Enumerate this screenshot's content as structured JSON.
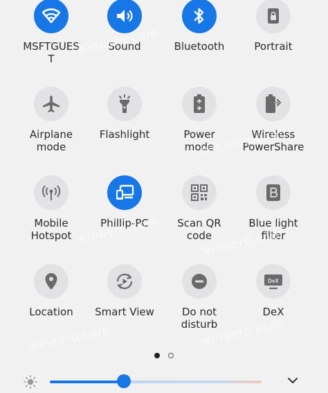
{
  "tiles": [
    {
      "label": "MSFTGUES\nT",
      "icon": "wifi-icon",
      "on": true
    },
    {
      "label": "Sound",
      "icon": "sound-icon",
      "on": true
    },
    {
      "label": "Bluetooth",
      "icon": "bluetooth-icon",
      "on": true
    },
    {
      "label": "Portrait",
      "icon": "portrait-lock-icon",
      "on": false
    },
    {
      "label": "Airplane\nmode",
      "icon": "airplane-icon",
      "on": false
    },
    {
      "label": "Flashlight",
      "icon": "flashlight-icon",
      "on": false
    },
    {
      "label": "Power\nmode",
      "icon": "power-mode-icon",
      "on": false
    },
    {
      "label": "Wireless\nPowerShare",
      "icon": "wireless-powershare-icon",
      "on": false
    },
    {
      "label": "Mobile\nHotspot",
      "icon": "hotspot-icon",
      "on": false
    },
    {
      "label": "Phillip-PC",
      "icon": "devices-icon",
      "on": true
    },
    {
      "label": "Scan QR\ncode",
      "icon": "qr-code-icon",
      "on": false
    },
    {
      "label": "Blue light\nfilter",
      "icon": "blue-light-filter-icon",
      "on": false
    },
    {
      "label": "Location",
      "icon": "location-icon",
      "on": false
    },
    {
      "label": "Smart View",
      "icon": "smart-view-icon",
      "on": false
    },
    {
      "label": "Do not\ndisturb",
      "icon": "do-not-disturb-icon",
      "on": false
    },
    {
      "label": "DeX",
      "icon": "dex-icon",
      "on": false
    }
  ],
  "dex_badge": "DeX",
  "pager": {
    "current_page": 1,
    "total_pages": 2
  },
  "brightness": {
    "level": 0.35
  },
  "colors": {
    "accent": "#1877e6",
    "tile_off": "#e2e2e4",
    "background": "#f1f1f2"
  },
  "watermark_text": "winaero.com"
}
